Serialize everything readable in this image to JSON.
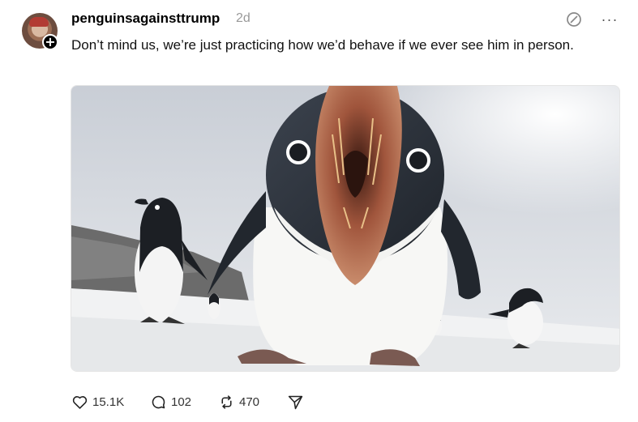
{
  "post": {
    "username": "penguinsagainsttrump",
    "time": "2d",
    "caption": "Don’t mind us, we’re just practicing how we’d behave if we ever see him in person.",
    "image_alt": "Penguins",
    "likes": "15.1K",
    "replies": "102",
    "reposts": "470",
    "more": "···",
    "follow_glyph": "+"
  },
  "icons": [
    "no-entry-icon",
    "more-icon",
    "heart-icon",
    "reply-icon",
    "repost-icon",
    "share-icon"
  ]
}
